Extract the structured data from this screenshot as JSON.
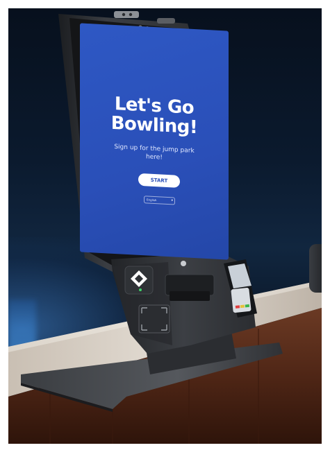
{
  "kiosk": {
    "screen": {
      "title": "Let's Go\nBowling!",
      "subtitle": "Sign up for the jump park here!",
      "start_label": "START",
      "language_label": "English"
    }
  },
  "colors": {
    "screen_blue": "#2a4fb8",
    "kiosk_body": "#2f3236",
    "counter_wood": "#5a2d1c",
    "counter_top": "#d8d1c8",
    "background_night": "#0b1a2e"
  },
  "icons": {
    "scanner": "diamond-icon",
    "camera": "camera-icon",
    "status_led": "green-led-icon"
  }
}
